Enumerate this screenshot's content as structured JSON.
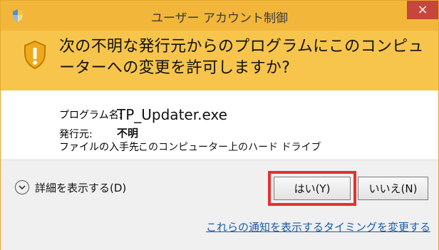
{
  "window": {
    "title": "ユーザー アカウント制御",
    "close_symbol": "×"
  },
  "banner": {
    "message": "次の不明な発行元からのプログラムにこのコンピューターへの変更を許可しますか?"
  },
  "details": {
    "program_name_label": "プログラム名:",
    "program_name_value": "TP_Updater.exe",
    "publisher_label": "発行元:",
    "publisher_value": "不明",
    "file_origin_label": "ファイルの入手先:",
    "file_origin_value": "このコンピューター上のハード ドライブ"
  },
  "footer": {
    "show_details_label": "詳細を表示する(D)",
    "yes_button": "はい(Y)",
    "no_button": "いいえ(N)",
    "change_notification_link": "これらの通知を表示するタイミングを変更する"
  },
  "colors": {
    "title_bar": "#f2b73a",
    "banner": "#f7c54c",
    "close_button": "#c7463b",
    "highlight": "#e53030",
    "link": "#1c5ba8"
  },
  "icons": {
    "title_icon": "uac-shield-icon",
    "banner_icon": "warning-shield-icon",
    "toggle_icon": "chevron-down-icon",
    "close_icon": "close-icon"
  }
}
